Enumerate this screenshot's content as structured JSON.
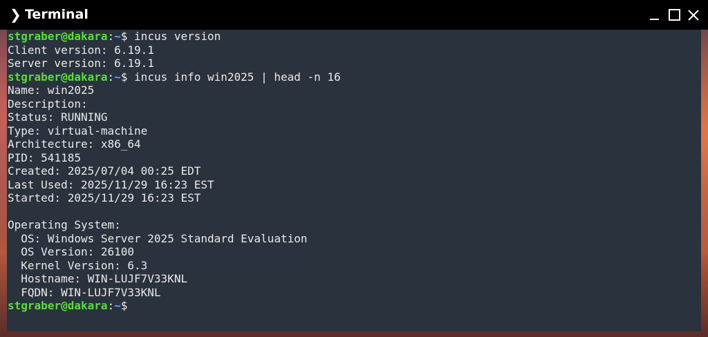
{
  "window": {
    "title": "Terminal",
    "title_icon": "chevron-right-icon"
  },
  "terminal": {
    "prompt": {
      "user_host": "stgraber@dakara",
      "separator": ":",
      "path": "~",
      "symbol": "$ "
    },
    "lines": [
      {
        "type": "prompt",
        "command": "incus version"
      },
      {
        "type": "output",
        "text": "Client version: 6.19.1"
      },
      {
        "type": "output",
        "text": "Server version: 6.19.1"
      },
      {
        "type": "prompt",
        "command": "incus info win2025 | head -n 16"
      },
      {
        "type": "output",
        "text": "Name: win2025"
      },
      {
        "type": "output",
        "text": "Description:"
      },
      {
        "type": "output",
        "text": "Status: RUNNING"
      },
      {
        "type": "output",
        "text": "Type: virtual-machine"
      },
      {
        "type": "output",
        "text": "Architecture: x86_64"
      },
      {
        "type": "output",
        "text": "PID: 541185"
      },
      {
        "type": "output",
        "text": "Created: 2025/07/04 00:25 EDT"
      },
      {
        "type": "output",
        "text": "Last Used: 2025/11/29 16:23 EST"
      },
      {
        "type": "output",
        "text": "Started: 2025/11/29 16:23 EST"
      },
      {
        "type": "output",
        "text": ""
      },
      {
        "type": "output",
        "text": "Operating System:"
      },
      {
        "type": "output",
        "text": "  OS: Windows Server 2025 Standard Evaluation"
      },
      {
        "type": "output",
        "text": "  OS Version: 26100"
      },
      {
        "type": "output",
        "text": "  Kernel Version: 6.3"
      },
      {
        "type": "output",
        "text": "  Hostname: WIN-LUJF7V33KNL"
      },
      {
        "type": "output",
        "text": "  FQDN: WIN-LUJF7V33KNL"
      },
      {
        "type": "prompt",
        "command": ""
      }
    ]
  },
  "colors": {
    "titlebar": "#000000",
    "terminal_bg": "#2a323d",
    "prompt_user": "#55e038",
    "prompt_path": "#6aa0ff",
    "text": "#eaeaea"
  }
}
